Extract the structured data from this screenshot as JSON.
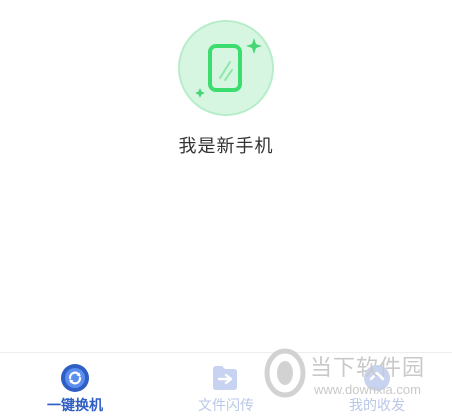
{
  "hero": {
    "label": "我是新手机",
    "icon": "new-phone-icon",
    "colors": {
      "circle": "#d7f6e2",
      "phone": "#3ddc6f",
      "sparkle": "#46d676"
    }
  },
  "tabbar": {
    "tabs": [
      {
        "label": "一键换机",
        "icon": "switch-phone-icon",
        "active": true
      },
      {
        "label": "文件闪传",
        "icon": "file-transfer-icon",
        "active": false
      },
      {
        "label": "我的收发",
        "icon": "my-transfers-icon",
        "active": false
      }
    ],
    "colors": {
      "active": "#2f5fc5",
      "inactive": "#b9c7ea"
    }
  },
  "watermark": {
    "logo": "downxia-logo",
    "text": "当下软件园",
    "url": "www.downxia.com"
  }
}
